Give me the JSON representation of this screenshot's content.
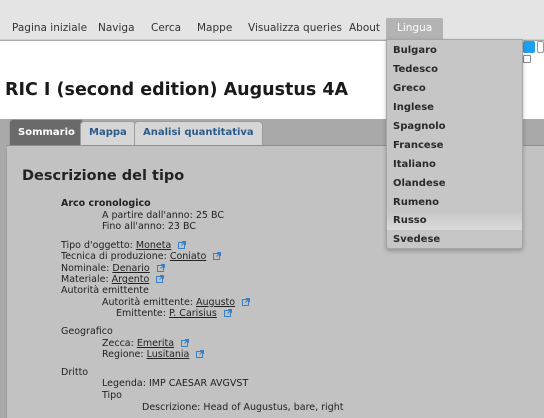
{
  "nav": {
    "items": [
      {
        "label": "Pagina iniziale"
      },
      {
        "label": "Naviga"
      },
      {
        "label": "Cerca"
      },
      {
        "label": "Mappe"
      },
      {
        "label": "Visualizza queries"
      },
      {
        "label": "About"
      },
      {
        "label": "Lingua"
      }
    ]
  },
  "page": {
    "title": "RIC I (second edition) Augustus 4A"
  },
  "tabs": [
    {
      "label": "Sommario"
    },
    {
      "label": "Mappa"
    },
    {
      "label": "Analisi quantitativa"
    }
  ],
  "section": {
    "title": "Descrizione del tipo"
  },
  "fields": {
    "arco": "Arco cronologico",
    "da_label": "A partire dall'anno:",
    "da_value": "25 BC",
    "fino_label": "Fino all'anno:",
    "fino_value": "23 BC",
    "tipo_label": "Tipo d'oggetto:",
    "tipo_value": "Moneta",
    "tecnica_label": "Tecnica di produzione:",
    "tecnica_value": "Coniato",
    "nominale_label": "Nominale:",
    "nominale_value": "Denario",
    "materiale_label": "Materiale:",
    "materiale_value": "Argento",
    "autorita": "Autorità emittente",
    "aut_em_label": "Autorità emittente:",
    "aut_em_value": "Augusto",
    "emittente_label": "Emittente:",
    "emittente_value": "P. Carisius",
    "geografico": "Geografico",
    "zecca_label": "Zecca:",
    "zecca_value": "Emerita",
    "regione_label": "Regione:",
    "regione_value": "Lusitania",
    "dritto": "Dritto",
    "legenda_label": "Legenda:",
    "legenda_value": "IMP CAESAR AVGVST",
    "tipo2": "Tipo",
    "descr_label": "Descrizione:",
    "descr_value": "Head of Augustus, bare, right"
  },
  "language_menu": {
    "items": [
      "Bulgaro",
      "Tedesco",
      "Greco",
      "Inglese",
      "Spagnolo",
      "Francese",
      "Italiano",
      "Olandese",
      "Rumeno",
      "Russo",
      "Svedese"
    ]
  },
  "colors": {
    "tab_link": "#2b5b8a",
    "external_link_icon": "#3a7fc4",
    "twitter": "#1da1f2"
  }
}
